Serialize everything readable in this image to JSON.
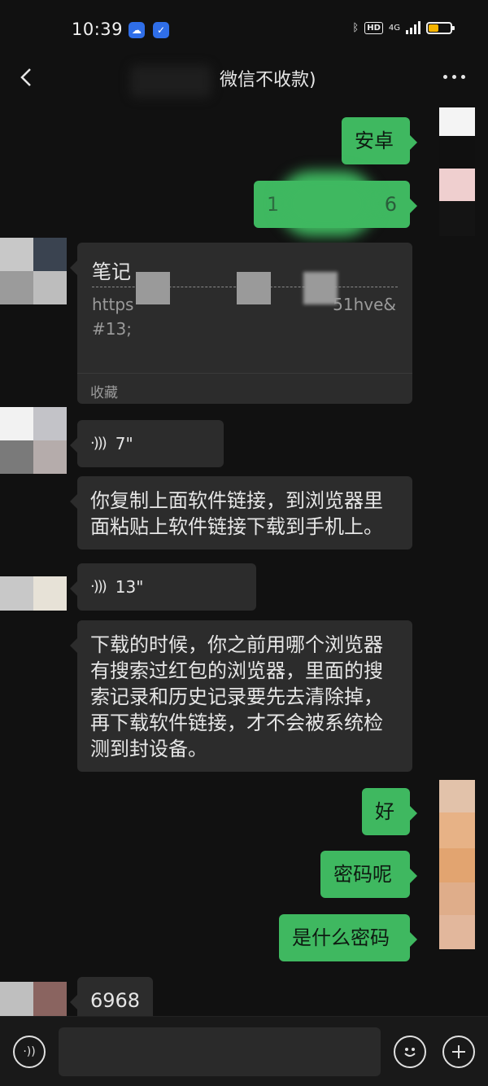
{
  "status_bar": {
    "time": "10:39",
    "network": "4G",
    "hd": "HD",
    "battery_level": 0.45,
    "app_icon_1": "cloud-icon",
    "app_icon_2": "shield-icon"
  },
  "header": {
    "title": "微信不收款)",
    "back_icon": "chevron-left-icon",
    "more_icon": "more-dots-icon"
  },
  "messages": {
    "m1": "安卓",
    "m2_left": "1",
    "m2_right": "6",
    "note_card": {
      "title": "笔记",
      "link_prefix": "https",
      "link_suffix": "51hve&",
      "link_line2": "#13;",
      "footer": "收藏"
    },
    "voice1": "7\"",
    "text1": "你复制上面软件链接，到浏览器里面粘贴上软件链接下载到手机上。",
    "voice2": "13\"",
    "text2": "下载的时候，你之前用哪个浏览器有搜索过红包的浏览器，里面的搜索记录和历史记录要先去清除掉，再下载软件链接，才不会被系统检测到封设备。",
    "m3": "好",
    "m4": "密码呢",
    "m5": "是什么密码",
    "m6": "6968"
  },
  "input_bar": {
    "voice_icon": "voice-mode-icon",
    "emoji_icon": "emoji-icon",
    "plus_icon": "plus-icon",
    "placeholder": ""
  },
  "colors": {
    "background": "#111111",
    "bubble_out": "#3fb860",
    "bubble_in": "#2c2c2c",
    "battery": "#f5b400"
  }
}
